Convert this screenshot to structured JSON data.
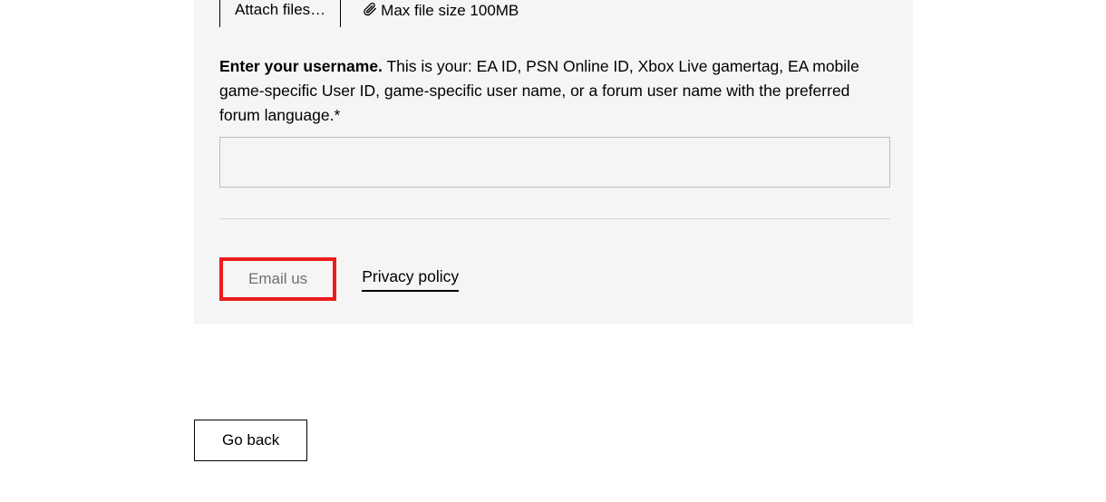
{
  "attach": {
    "button_label": "Attach files…",
    "max_size_text": "Max file size 100MB"
  },
  "prompt": {
    "strong": "Enter your username.",
    "rest": " This is your: EA ID, PSN Online ID, Xbox Live gamertag, EA mobile game-specific User ID, game-specific user name, or a forum user name with the preferred forum language.*"
  },
  "username": {
    "value": ""
  },
  "actions": {
    "email_label": "Email us",
    "privacy_label": "Privacy policy"
  },
  "nav": {
    "go_back_label": "Go back"
  }
}
